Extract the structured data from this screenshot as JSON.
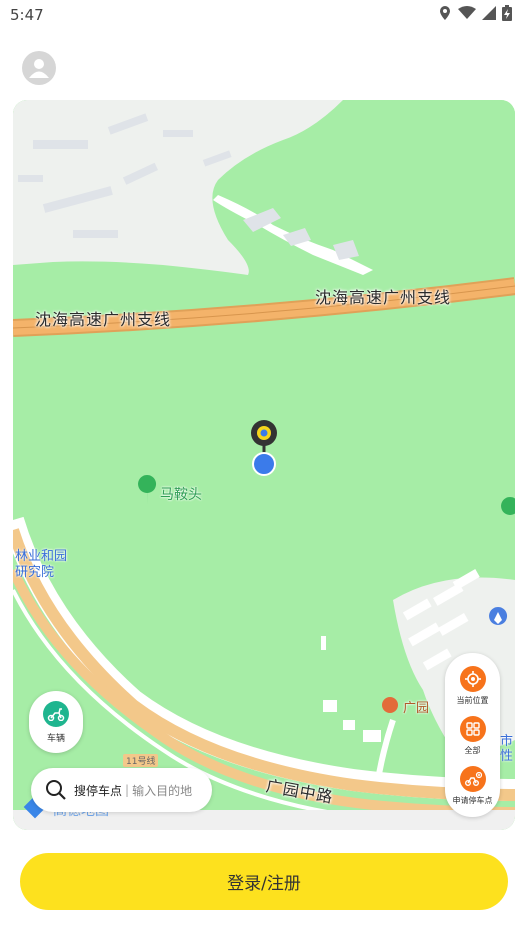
{
  "status_bar": {
    "time": "5:47",
    "icons": [
      "location-icon",
      "wifi-icon",
      "signal-icon",
      "battery-charging-icon"
    ]
  },
  "header": {
    "avatar_icon": "user-avatar-icon"
  },
  "map": {
    "road_labels": [
      "沈海高速广州支线",
      "沈海高速广州支线",
      "广园中路"
    ],
    "poi_labels": [
      "马鞍头",
      "广园"
    ],
    "partial_labels": [
      "林业和园",
      "研究院",
      "11号线",
      "市",
      "性"
    ],
    "watermark": "高德地图",
    "colors": {
      "park": "#a6eda6",
      "highway": "#f4b36a",
      "pin": "#3b7bea"
    }
  },
  "controls": {
    "vehicle_label": "车辆",
    "search_main": "搜停车点",
    "search_separator": "|",
    "search_hint": "输入目的地",
    "side_items": [
      {
        "label": "当前位置",
        "icon": "locate-icon"
      },
      {
        "label": "全部",
        "icon": "grid-icon"
      },
      {
        "label": "申请停车点",
        "icon": "scooter-add-icon"
      }
    ],
    "accent_orange": "#f7731b",
    "accent_green": "#1fb58f"
  },
  "footer": {
    "login_label": "登录/注册",
    "button_color": "#fde11e"
  }
}
